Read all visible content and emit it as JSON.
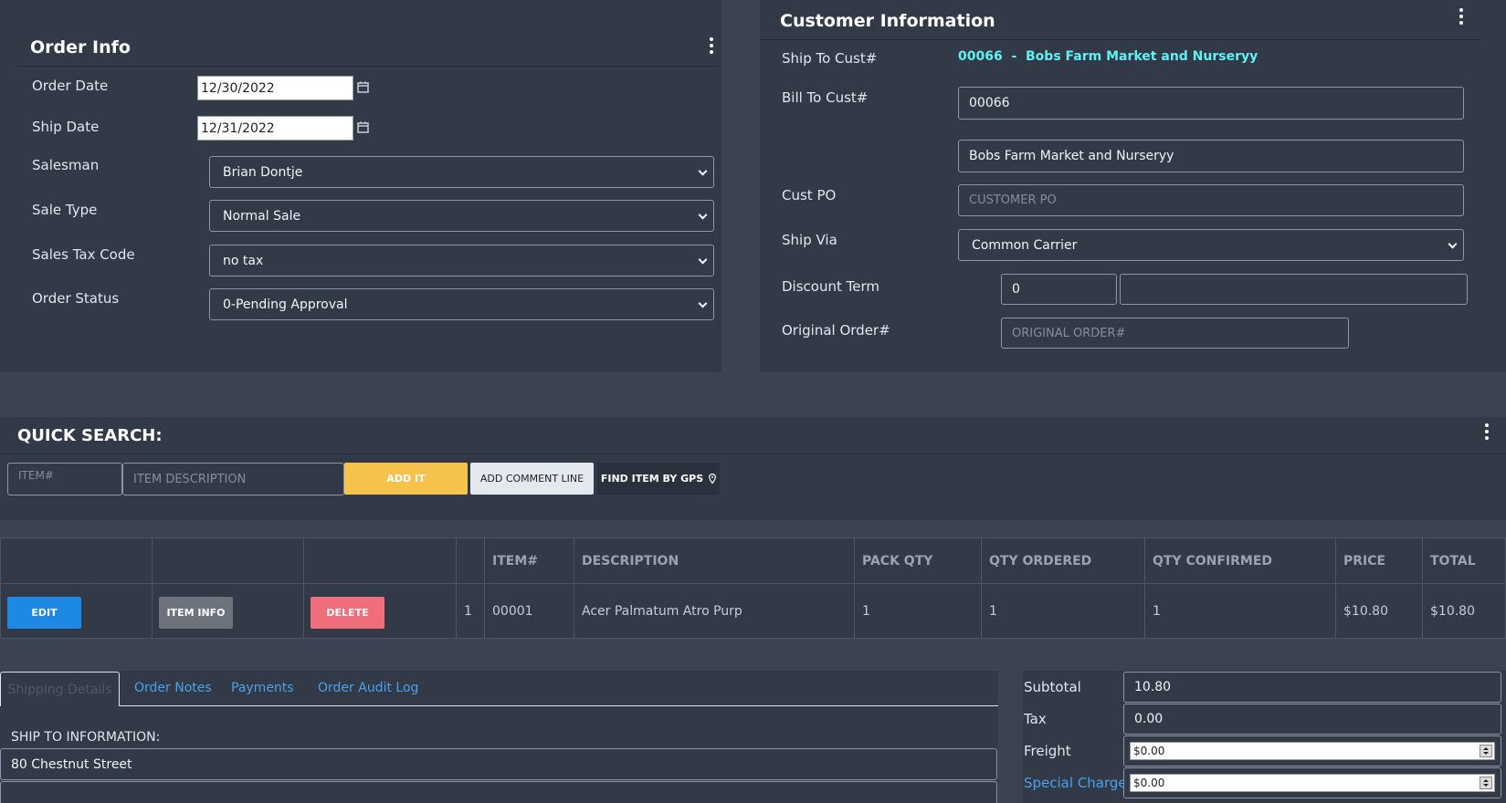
{
  "order_info": {
    "title": "Order Info",
    "order_date_label": "Order Date",
    "order_date": "12/30/2022",
    "ship_date_label": "Ship Date",
    "ship_date": "12/31/2022",
    "salesman_label": "Salesman",
    "salesman": "Brian Dontje",
    "sale_type_label": "Sale Type",
    "sale_type": "Normal Sale",
    "tax_code_label": "Sales Tax Code",
    "tax_code": "no tax",
    "status_label": "Order Status",
    "status": "0-Pending Approval"
  },
  "customer": {
    "title": "Customer Information",
    "ship_to_label": "Ship To Cust#",
    "ship_to_value": "00066  -  Bobs Farm Market and Nurseryy",
    "bill_to_label": "Bill To Cust#",
    "bill_to_number": "00066",
    "bill_to_name": "Bobs Farm Market and Nurseryy",
    "cust_po_label": "Cust PO",
    "cust_po_placeholder": "CUSTOMER PO",
    "ship_via_label": "Ship Via",
    "ship_via": "Common Carrier",
    "discount_label": "Discount Term",
    "discount_value": "0",
    "discount_desc": "",
    "original_order_label": "Original Order#",
    "original_order_placeholder": "ORIGINAL ORDER#"
  },
  "quick_search": {
    "title": "QUICK SEARCH:",
    "item_placeholder": "ITEM#",
    "desc_placeholder": "ITEM DESCRIPTION",
    "add_it": "ADD IT",
    "add_comment": "ADD COMMENT LINE",
    "find_gps": "FIND ITEM BY GPS"
  },
  "table": {
    "headers": [
      "",
      "",
      "",
      "",
      "ITEM#",
      "DESCRIPTION",
      "PACK QTY",
      "QTY ORDERED",
      "QTY CONFIRMED",
      "PRICE",
      "TOTAL"
    ],
    "row": {
      "edit": "EDIT",
      "item_info": "ITEM INFO",
      "delete": "DELETE",
      "line": "1",
      "item": "00001",
      "description": "Acer Palmatum Atro Purp",
      "pack_qty": "1",
      "qty_ordered": "1",
      "qty_confirmed": "1",
      "price": "$10.80",
      "total": "$10.80"
    }
  },
  "tabs": [
    "Shipping Details",
    "Order Notes",
    "Payments",
    "Order Audit Log"
  ],
  "shipping": {
    "heading": "SHIP TO INFORMATION:",
    "address1": "80 Chestnut Street",
    "address2": ""
  },
  "totals": {
    "subtotal_label": "Subtotal",
    "subtotal": "10.80",
    "tax_label": "Tax",
    "tax": "0.00",
    "freight_label": "Freight",
    "freight": "$0.00",
    "special_label": "Special Charge",
    "special": "$0.00"
  },
  "colors": {
    "add_it": "#f6c24e",
    "edit": "#1e88e5",
    "item_info": "#6c737d",
    "delete": "#f06e7c",
    "link": "#4aa0ee",
    "cyan": "#5ef2f5"
  }
}
